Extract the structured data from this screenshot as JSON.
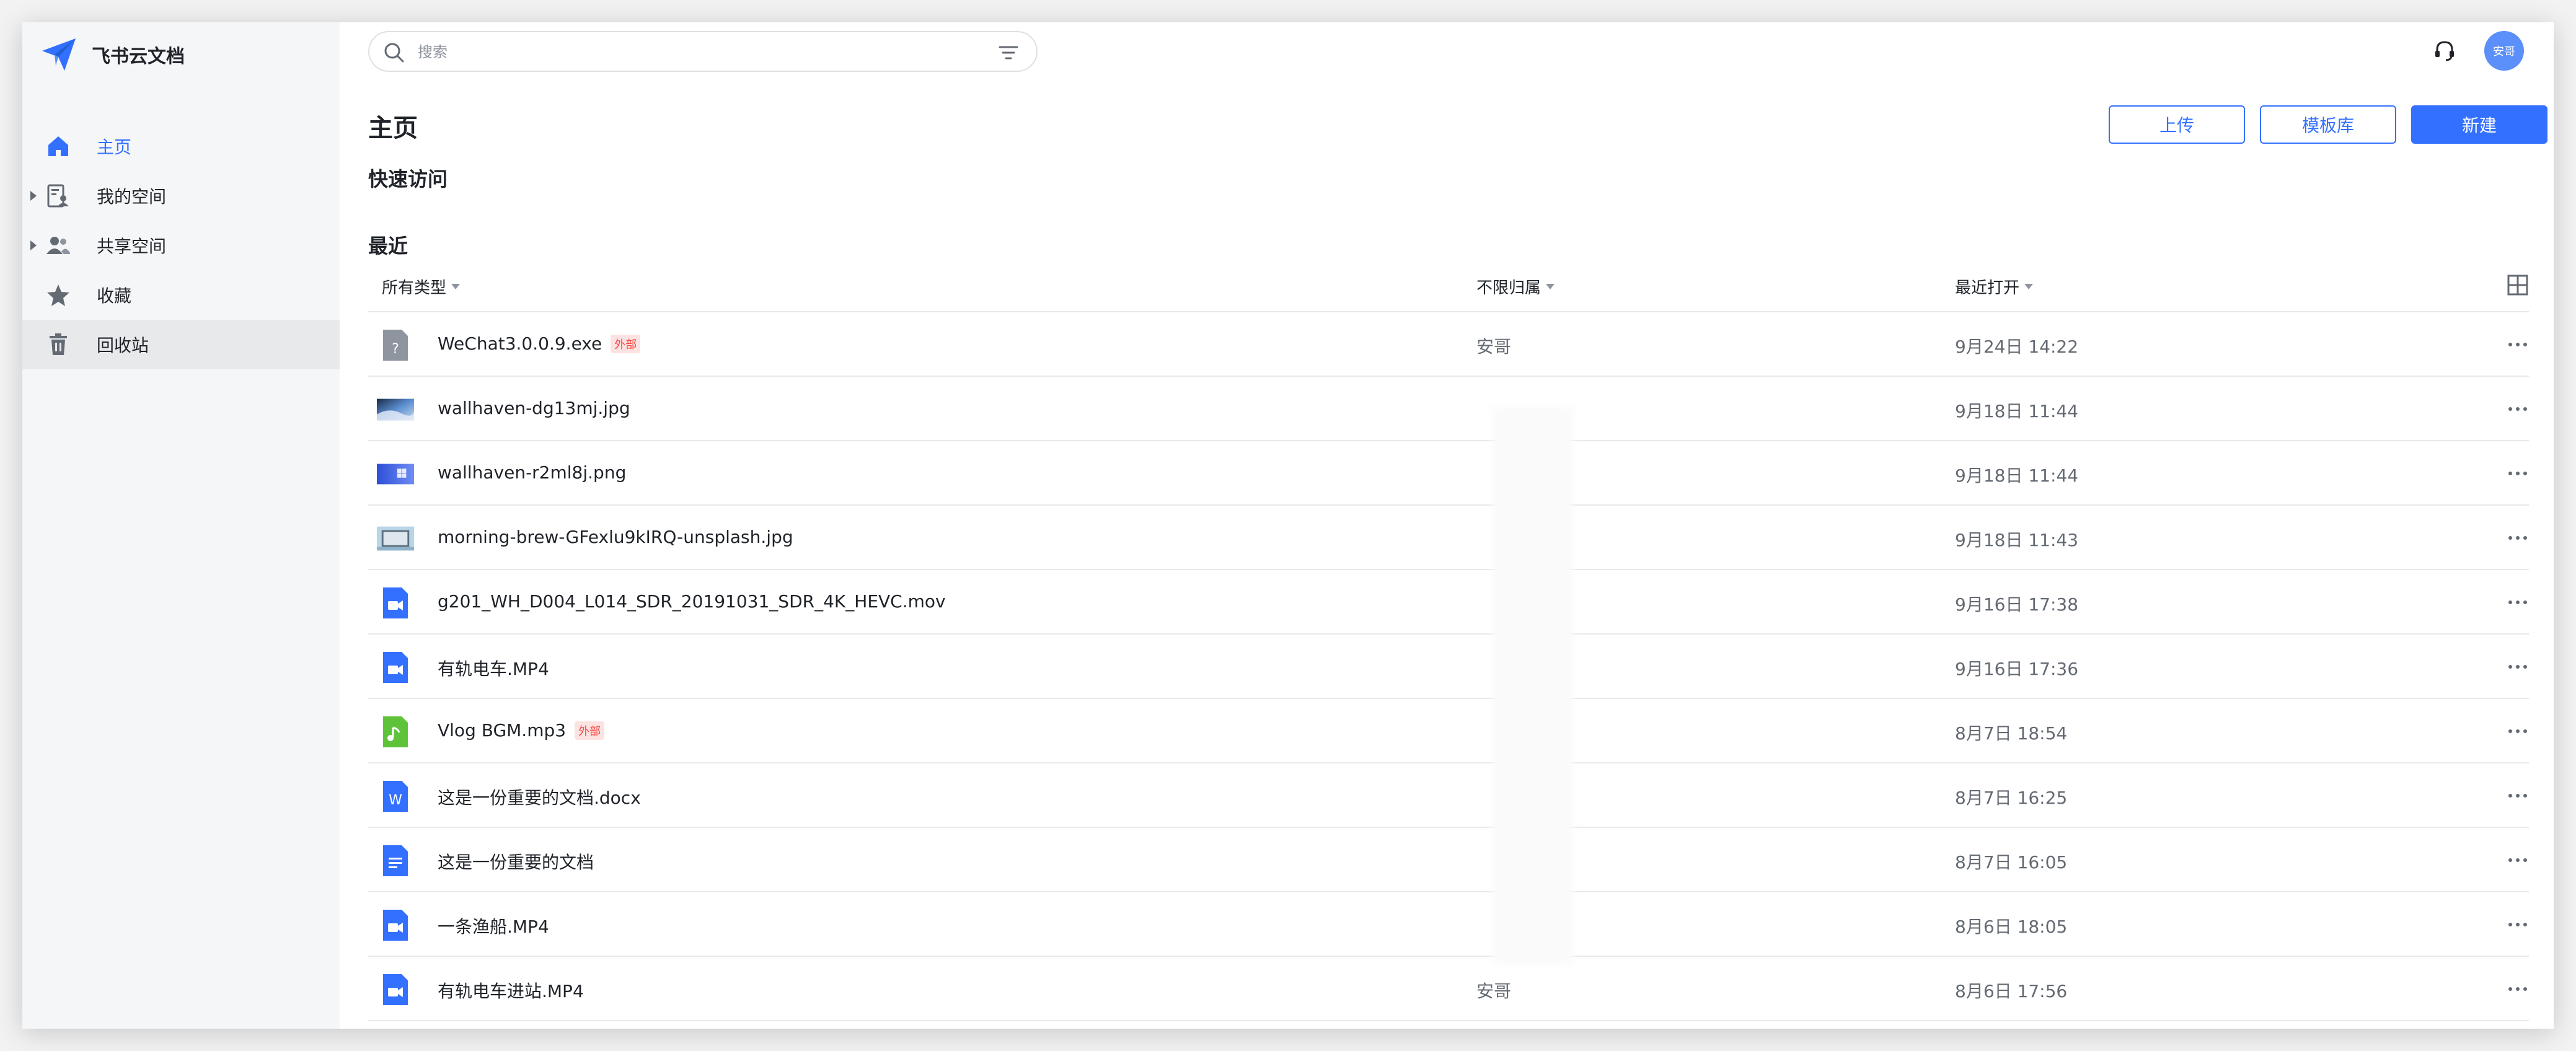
{
  "app": {
    "name": "飞书云文档"
  },
  "sidebar": {
    "items": [
      {
        "label": "主页",
        "icon": "home-icon"
      },
      {
        "label": "我的空间",
        "icon": "my-space-icon"
      },
      {
        "label": "共享空间",
        "icon": "shared-space-icon"
      },
      {
        "label": "收藏",
        "icon": "star-icon"
      },
      {
        "label": "回收站",
        "icon": "trash-icon"
      }
    ]
  },
  "topbar": {
    "search_placeholder": "搜索",
    "avatar_text": "安哥"
  },
  "page": {
    "title": "主页",
    "quick_access": "快速访问",
    "recent": "最近"
  },
  "actions": {
    "upload": "上传",
    "templates": "模板库",
    "new": "新建"
  },
  "table": {
    "columns": {
      "type": "所有类型",
      "owner": "不限归属",
      "opened": "最近打开"
    },
    "rows": [
      {
        "name": "WeChat3.0.0.9.exe",
        "tag": "外部",
        "owner": "安哥",
        "opened": "9月24日 14:22",
        "icon": "unknown-file-icon"
      },
      {
        "name": "wallhaven-dg13mj.jpg",
        "tag": "",
        "owner": "",
        "opened": "9月18日 11:44",
        "icon": "image-thumb-icon"
      },
      {
        "name": "wallhaven-r2ml8j.png",
        "tag": "",
        "owner": "",
        "opened": "9月18日 11:44",
        "icon": "image-thumb-icon"
      },
      {
        "name": "morning-brew-GFexlu9kIRQ-unsplash.jpg",
        "tag": "",
        "owner": "",
        "opened": "9月18日 11:43",
        "icon": "image-thumb-icon"
      },
      {
        "name": "g201_WH_D004_L014_SDR_20191031_SDR_4K_HEVC.mov",
        "tag": "",
        "owner": "",
        "opened": "9月16日 17:38",
        "icon": "video-file-icon"
      },
      {
        "name": "有轨电车.MP4",
        "tag": "",
        "owner": "",
        "opened": "9月16日 17:36",
        "icon": "video-file-icon"
      },
      {
        "name": "Vlog BGM.mp3",
        "tag": "外部",
        "owner": "",
        "opened": "8月7日 18:54",
        "icon": "audio-file-icon"
      },
      {
        "name": "这是一份重要的文档.docx",
        "tag": "",
        "owner": "",
        "opened": "8月7日 16:25",
        "icon": "word-file-icon"
      },
      {
        "name": "这是一份重要的文档",
        "tag": "",
        "owner": "",
        "opened": "8月7日 16:05",
        "icon": "doc-file-icon"
      },
      {
        "name": "一条渔船.MP4",
        "tag": "",
        "owner": "",
        "opened": "8月6日 18:05",
        "icon": "video-file-icon"
      },
      {
        "name": "有轨电车进站.MP4",
        "tag": "",
        "owner": "安哥",
        "opened": "8月6日 17:56",
        "icon": "video-file-icon"
      }
    ]
  },
  "colors": {
    "accent": "#3370ff",
    "tag_red": "#f54a45",
    "sidebar_bg": "#f5f6f7"
  }
}
